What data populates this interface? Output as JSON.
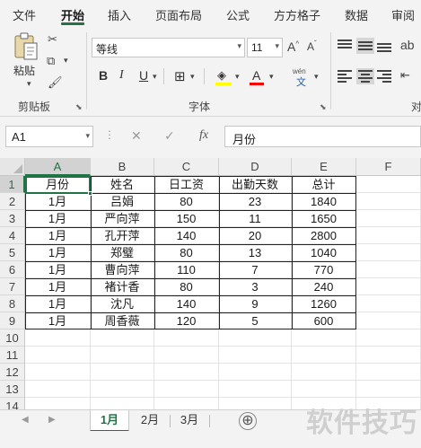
{
  "menu": {
    "tabs": [
      {
        "label": "文件",
        "active": false
      },
      {
        "label": "开始",
        "active": true
      },
      {
        "label": "插入",
        "active": false
      },
      {
        "label": "页面布局",
        "active": false
      },
      {
        "label": "公式",
        "active": false
      },
      {
        "label": "方方格子",
        "active": false
      },
      {
        "label": "数据",
        "active": false
      },
      {
        "label": "审阅",
        "active": false
      }
    ]
  },
  "ribbon": {
    "clipboard": {
      "paste_label": "粘贴",
      "group_label": "剪贴板"
    },
    "font": {
      "font_name": "等线",
      "font_size": "11",
      "group_label": "字体",
      "phonetic_label": "wén",
      "phonetic_char": "文"
    },
    "alignment": {
      "group_label": "对"
    }
  },
  "formula_bar": {
    "name_box": "A1",
    "fx_label": "fx",
    "formula": "月份"
  },
  "sheet": {
    "columns": [
      "A",
      "B",
      "C",
      "D",
      "E",
      "F"
    ],
    "rows": [
      [
        "月份",
        "姓名",
        "日工资",
        "出勤天数",
        "总计"
      ],
      [
        "1月",
        "吕娟",
        "80",
        "23",
        "1840"
      ],
      [
        "1月",
        "严向萍",
        "150",
        "11",
        "1650"
      ],
      [
        "1月",
        "孔开萍",
        "140",
        "20",
        "2800"
      ],
      [
        "1月",
        "郑璧",
        "80",
        "13",
        "1040"
      ],
      [
        "1月",
        "曹向萍",
        "110",
        "7",
        "770"
      ],
      [
        "1月",
        "褚计香",
        "80",
        "3",
        "240"
      ],
      [
        "1月",
        "沈凡",
        "140",
        "9",
        "1260"
      ],
      [
        "1月",
        "周香薇",
        "120",
        "5",
        "600"
      ]
    ],
    "row_numbers": [
      "1",
      "2",
      "3",
      "4",
      "5",
      "6",
      "7",
      "8",
      "9",
      "10",
      "11",
      "12",
      "13",
      "14"
    ],
    "selected_cell": "A1"
  },
  "sheet_tabs": [
    {
      "label": "1月",
      "active": true
    },
    {
      "label": "2月",
      "active": false
    },
    {
      "label": "3月",
      "active": false
    }
  ],
  "add_sheet": "⊕",
  "watermark": "软件技巧",
  "colors": {
    "accent": "#217346",
    "highlight_yellow": "#ffff00",
    "font_red": "#ff0000"
  }
}
